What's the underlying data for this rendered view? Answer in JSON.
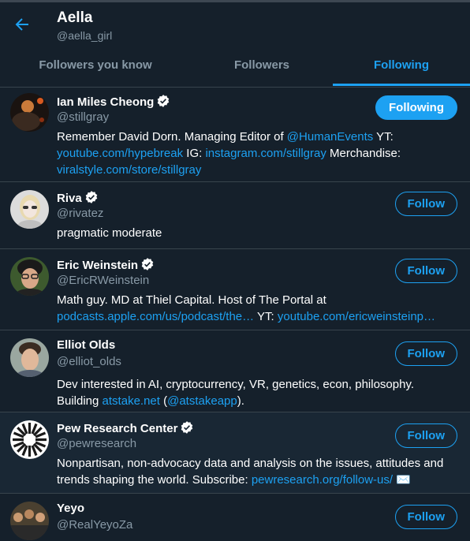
{
  "header": {
    "name": "Aella",
    "handle": "@aella_girl"
  },
  "tabs": [
    {
      "label": "Followers you know"
    },
    {
      "label": "Followers"
    },
    {
      "label": "Following"
    }
  ],
  "accent_color": "#1da1f2",
  "users": [
    {
      "name": "Ian Miles Cheong",
      "handle": "@stillgray",
      "verified": true,
      "button": "Following",
      "bio": {
        "p1": "Remember David Dorn. Managing Editor of ",
        "l1": "@HumanEvents",
        "p2": " YT: ",
        "l2": "youtube.com/hypebreak",
        "p3": " IG: ",
        "l3": "instagram.com/stillgray",
        "p4": " Merchandise: ",
        "l4": "viralstyle.com/store/stillgray"
      }
    },
    {
      "name": "Riva",
      "handle": "@rivatez",
      "verified": true,
      "button": "Follow",
      "bio": {
        "p1": "pragmatic moderate"
      }
    },
    {
      "name": "Eric Weinstein",
      "handle": "@EricRWeinstein",
      "verified": true,
      "button": "Follow",
      "bio": {
        "p1": "Math guy. MD at Thiel Capital. Host of The Portal at ",
        "l1": "podcasts.apple.com/us/podcast/the…",
        "p2": " YT: ",
        "l2": "youtube.com/ericweinsteinp…"
      }
    },
    {
      "name": "Elliot Olds",
      "handle": "@elliot_olds",
      "verified": false,
      "button": "Follow",
      "bio": {
        "p1": "Dev interested in AI, cryptocurrency, VR, genetics, econ, philosophy. Building ",
        "l1": "atstake.net",
        "p2": " (",
        "l2": "@atstakeapp",
        "p3": ")."
      }
    },
    {
      "name": "Pew Research Center",
      "handle": "@pewresearch",
      "verified": true,
      "button": "Follow",
      "bio": {
        "p1": "Nonpartisan, non-advocacy data and analysis on the issues, attitudes and trends shaping the world. Subscribe: ",
        "l1": "pewresearch.org/follow-us/",
        "p2": " ✉️"
      }
    },
    {
      "name": "Yeyo",
      "handle": "@RealYeyoZa",
      "verified": false,
      "button": "Follow"
    }
  ]
}
